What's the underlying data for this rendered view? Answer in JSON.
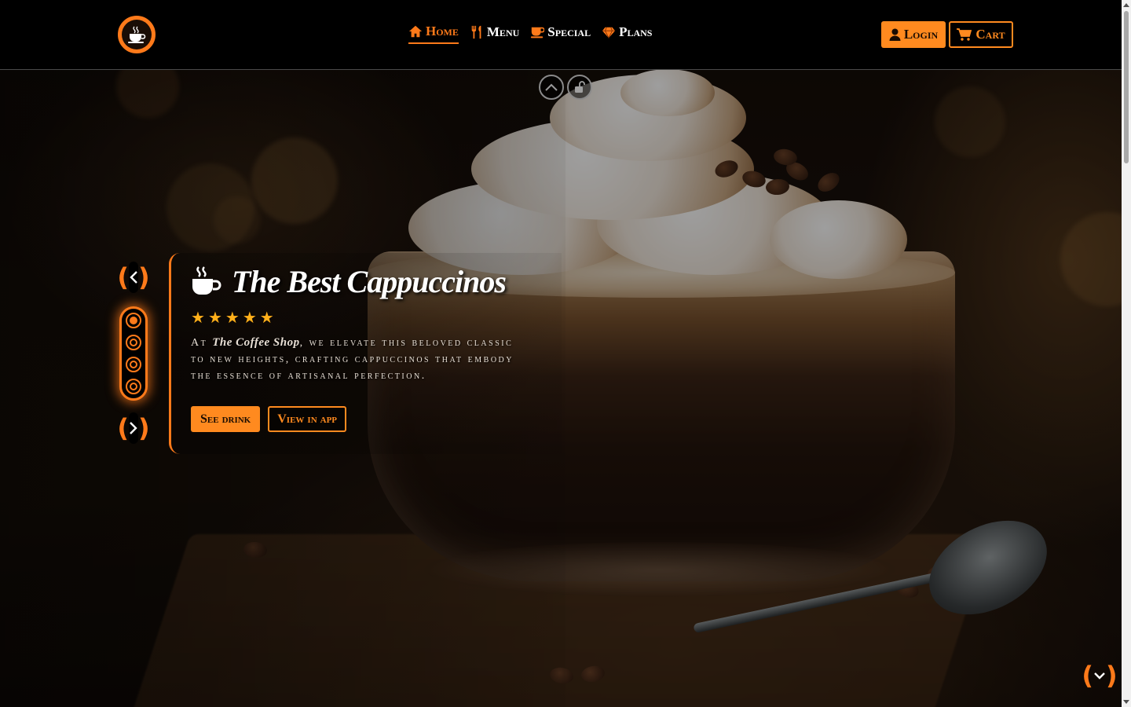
{
  "header": {
    "logo_icon": "coffee-cup-logo",
    "nav": [
      {
        "label": "Home",
        "icon": "home-icon",
        "active": true
      },
      {
        "label": "Menu",
        "icon": "utensils-icon",
        "active": false
      },
      {
        "label": "Special",
        "icon": "mug-icon",
        "active": false
      },
      {
        "label": "Plans",
        "icon": "gem-icon",
        "active": false
      }
    ],
    "login_label": "Login",
    "cart_label": "Cart"
  },
  "hero": {
    "title": "The Best Cappuccinos",
    "rating": 5,
    "description_prefix": "At ",
    "brand": "The Coffee Shop",
    "description_suffix": ", we elevate this beloved classic to new heights, crafting cappuccinos that embody the essence of artisanal perfection.",
    "primary_cta": "See drink",
    "secondary_cta": "View in app"
  },
  "slider": {
    "slide_count": 4,
    "active_index": 0
  },
  "colors": {
    "accent": "#ff7a1a",
    "star": "#ffb01a",
    "background": "#000000"
  }
}
